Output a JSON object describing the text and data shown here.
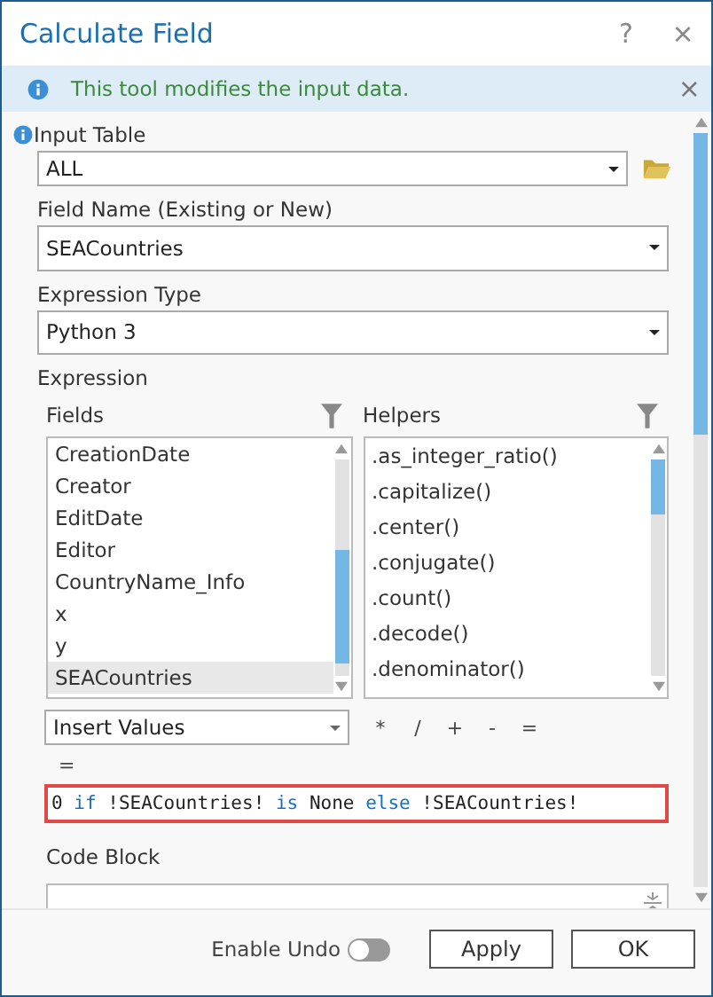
{
  "window": {
    "title": "Calculate Field",
    "help": "?",
    "close": "×"
  },
  "message": {
    "text": "This tool modifies the input data.",
    "close": "×"
  },
  "input_table": {
    "label": "Input Table",
    "value": "ALL"
  },
  "field_name": {
    "label": "Field Name (Existing or New)",
    "value": "SEACountries"
  },
  "expression_type": {
    "label": "Expression Type",
    "value": "Python 3"
  },
  "expression": {
    "label": "Expression",
    "fields": {
      "label": "Fields",
      "items": [
        {
          "name": "CreationDate",
          "selected": false
        },
        {
          "name": "Creator",
          "selected": false
        },
        {
          "name": "EditDate",
          "selected": false
        },
        {
          "name": "Editor",
          "selected": false
        },
        {
          "name": "CountryName_Info",
          "selected": false
        },
        {
          "name": "x",
          "selected": false
        },
        {
          "name": "y",
          "selected": false
        },
        {
          "name": "SEACountries",
          "selected": true
        }
      ]
    },
    "helpers": {
      "label": "Helpers",
      "items": [
        ".as_integer_ratio()",
        ".capitalize()",
        ".center()",
        ".conjugate()",
        ".count()",
        ".decode()",
        ".denominator()"
      ]
    },
    "insert": {
      "value": "Insert Values"
    },
    "operators": [
      "*",
      "/",
      "+",
      "-",
      "="
    ],
    "equals_line": "=",
    "code": [
      {
        "kind": "plain",
        "text": "0 "
      },
      {
        "kind": "keyword",
        "text": "if"
      },
      {
        "kind": "plain",
        "text": " !SEACountries! "
      },
      {
        "kind": "keyword",
        "text": "is"
      },
      {
        "kind": "plain",
        "text": " None "
      },
      {
        "kind": "keyword",
        "text": "else"
      },
      {
        "kind": "plain",
        "text": " !SEACountries!"
      }
    ]
  },
  "code_block": {
    "label": "Code Block"
  },
  "footer": {
    "enable_undo": {
      "label": "Enable Undo",
      "on": false
    },
    "buttons": [
      "Apply",
      "OK"
    ]
  }
}
